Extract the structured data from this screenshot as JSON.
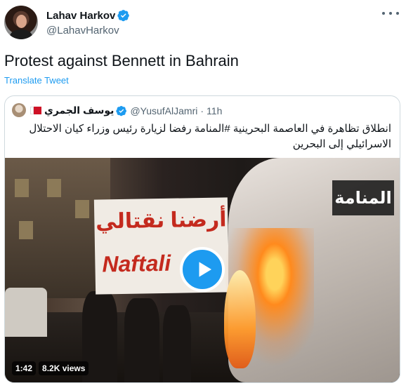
{
  "tweet": {
    "display_name": "Lahav Harkov",
    "handle": "@LahavHarkov",
    "text": "Protest against Bennett in Bahrain",
    "translate_label": "Translate Tweet"
  },
  "quoted": {
    "display_name": "يوسف الجمري",
    "handle": "@YusufAlJamri",
    "separator": "·",
    "time": "11h",
    "text": "انطلاق تظاهرة في العاصمة البحرينية #المنامة رفضا لزيارة رئيس وزراء كيان الاحتلال الاسرائيلي إلى البحرين"
  },
  "video": {
    "duration": "1:42",
    "views": "8.2K views",
    "overlay_label": "المنامة",
    "banner_arabic": "أرضنا نقتالي",
    "banner_english": "Naftali"
  },
  "colors": {
    "accent": "#1d9bf0",
    "text": "#0f1419",
    "muted": "#536471",
    "border": "#cfd9de"
  },
  "icons": [
    "verified-badge-icon",
    "more-options-icon",
    "bahrain-flag-icon",
    "play-icon"
  ]
}
